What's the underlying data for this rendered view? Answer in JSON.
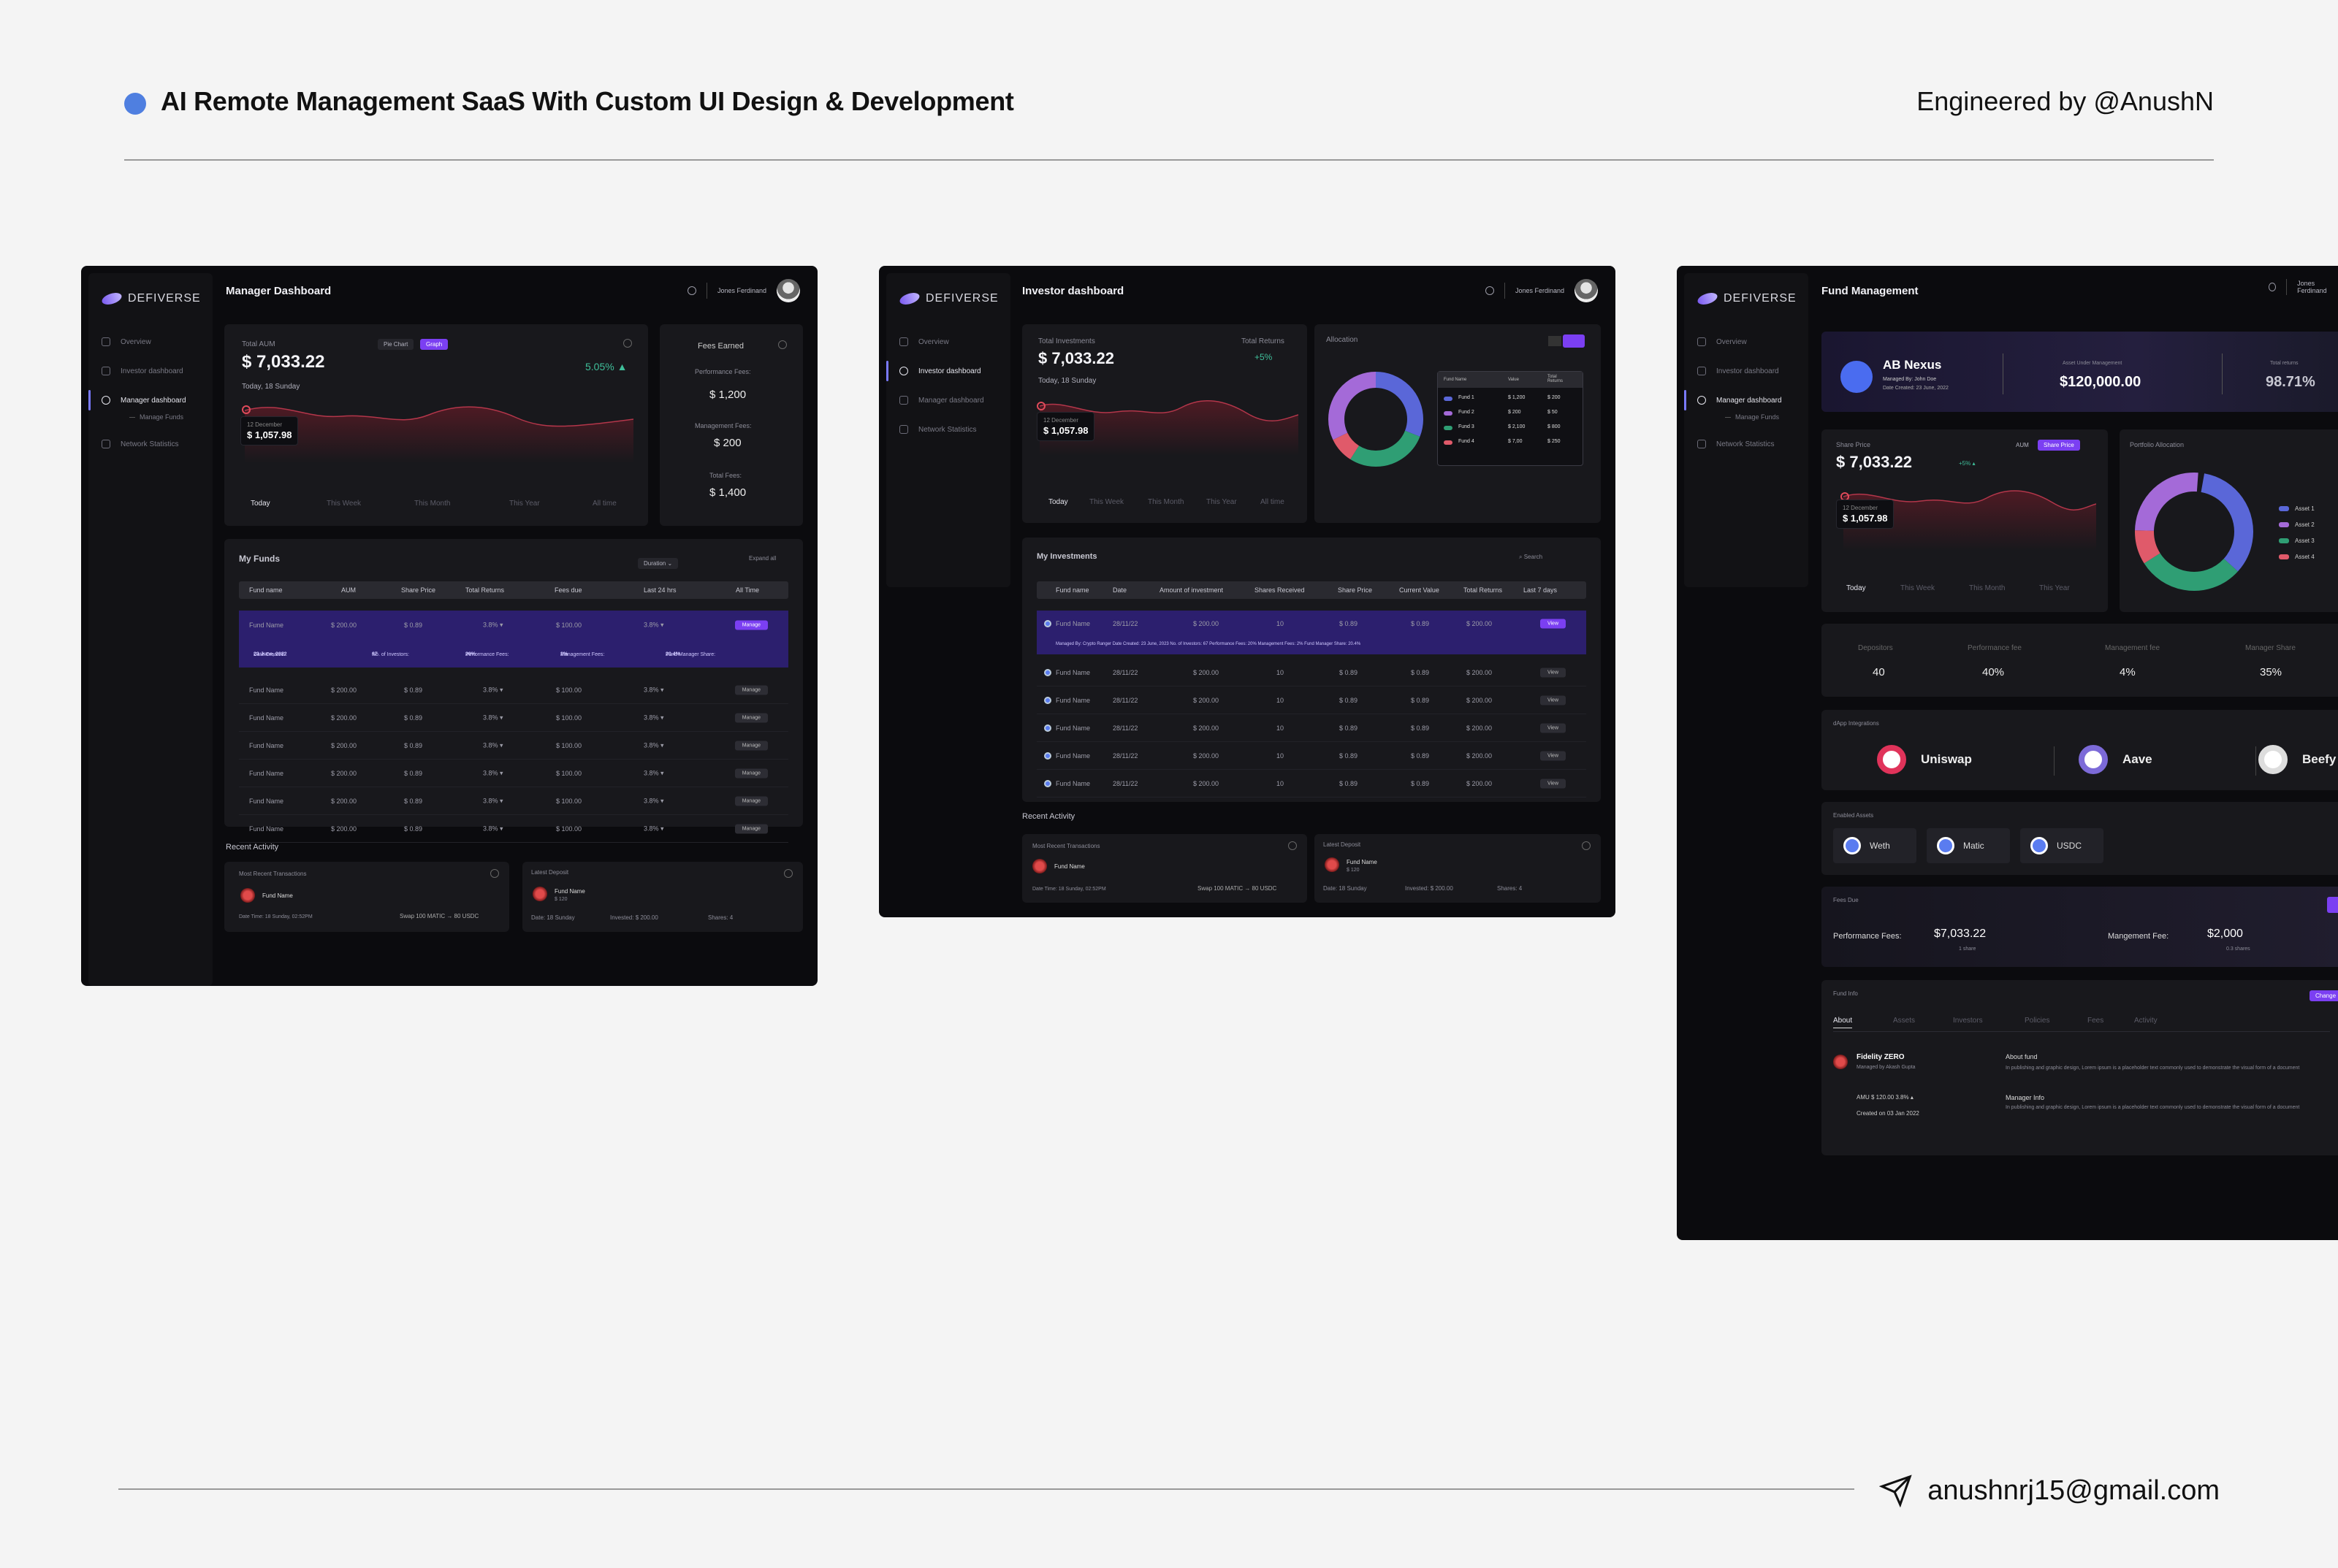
{
  "header": {
    "title": "AI Remote Management SaaS With Custom UI Design & Development",
    "credit": "Engineered by @AnushN"
  },
  "footer": {
    "email": "anushnrj15@gmail.com"
  },
  "brand": "DEFIVERSE",
  "user": "Jones Ferdinand",
  "nav": {
    "overview": "Overview",
    "investor": "Investor dashboard",
    "manager": "Manager dashboard",
    "manage_funds": "Manage Funds",
    "network": "Network Statistics"
  },
  "s1": {
    "title": "Manager Dashboard",
    "aum_label": "Total AUM",
    "aum": "$ 7,033.22",
    "aum_change": "5.05% ▲",
    "date": "Today, 18 Sunday",
    "toggle": [
      "Pie Chart",
      "Graph"
    ],
    "tip_date": "12 December",
    "tip_val": "$ 1,057.98",
    "ranges": [
      "Today",
      "This Week",
      "This Month",
      "This Year",
      "All time"
    ],
    "fees": {
      "title": "Fees Earned",
      "perf_l": "Performance Fees:",
      "perf": "$ 1,200",
      "mgmt_l": "Management Fees:",
      "mgmt": "$ 200",
      "tot_l": "Total Fees:",
      "tot": "$ 1,400"
    },
    "funds_title": "My Funds",
    "duration": "Duration ⌄",
    "expand": "Expand all",
    "cols": [
      "Fund name",
      "AUM",
      "Share Price",
      "Total Returns",
      "Fees due",
      "Last 24 hrs",
      "All Time"
    ],
    "row": [
      "Fund Name",
      "$ 200.00",
      "$ 0.89",
      "3.8% ▾",
      "$ 100.00",
      "3.8% ▾",
      "Manage"
    ],
    "detail": {
      "created_l": "Date Created:",
      "created": "23 June, 2022",
      "inv_l": "No. of Investors:",
      "inv": "67",
      "perf_l": "Performance Fees:",
      "perf": "20%",
      "mgmt_l": "Management Fees:",
      "mgmt": "2%",
      "share_l": "Fund Manager Share:",
      "share": "20.4%"
    },
    "recent": "Recent Activity",
    "tx": {
      "title": "Most Recent Transactions",
      "fund": "Fund Name",
      "time": "Date Time: 18 Sunday, 02:52PM",
      "swap": "Swap 100 MATIC → 80 USDC"
    },
    "dep": {
      "title": "Latest Deposit",
      "fund": "Fund Name",
      "sub": "$ 120",
      "date": "Date: 18 Sunday",
      "inv": "Invested: $ 200.00",
      "shares": "Shares: 4"
    }
  },
  "s2": {
    "title": "Investor dashboard",
    "inv_label": "Total Investments",
    "inv": "$ 7,033.22",
    "ret_label": "Total Returns",
    "ret": "+5%",
    "date": "Today, 18 Sunday",
    "tip_date": "12 December",
    "tip_val": "$ 1,057.98",
    "ranges": [
      "Today",
      "This Week",
      "This Month",
      "This Year",
      "All time"
    ],
    "alloc": "Allocation",
    "legend_cols": [
      "Fund Name",
      "Value",
      "Total Returns"
    ],
    "legend": [
      [
        "Fund 1",
        "$ 1,200",
        "$ 200"
      ],
      [
        "Fund 2",
        "$ 200",
        "$ 50"
      ],
      [
        "Fund 3",
        "$ 2,100",
        "$ 800"
      ],
      [
        "Fund 4",
        "$ 7,00",
        "$ 250"
      ]
    ],
    "inv_title": "My Investments",
    "search": "Search",
    "cols": [
      "Fund name",
      "Date",
      "Amount of investment",
      "Shares Received",
      "Share Price",
      "Current Value",
      "Total Returns",
      "Last 7 days"
    ],
    "row": [
      "Fund Name",
      "28/11/22",
      "$ 200.00",
      "10",
      "$ 0.89",
      "$ 0.89",
      "$ 200.00",
      "View"
    ],
    "detail": "Managed By: Crypto Ranger   Date Created: 23 June, 2023   No. of Investors: 67   Performance Fees: 20%   Management Fees: 2%   Fund Manager Share: 20.4%",
    "recent": "Recent Activity",
    "tx": {
      "title": "Most Recent Transactions",
      "fund": "Fund Name",
      "time": "Date Time: 18 Sunday, 02:52PM",
      "swap": "Swap 100 MATIC → 80 USDC"
    },
    "dep": {
      "title": "Latest Deposit",
      "fund": "Fund Name",
      "sub": "$ 120",
      "date": "Date: 18 Sunday",
      "inv": "Invested: $ 200.00",
      "shares": "Shares: 4"
    }
  },
  "s3": {
    "title": "Fund Management",
    "fund": "AB Nexus",
    "mgr": "Managed By: John Doe",
    "created": "Date Created: 23 June, 2022",
    "aum_l": "Asset Under Management",
    "aum": "$120,000.00",
    "ret_l": "Total returns",
    "ret": "98.71%",
    "sp_l": "Share Price",
    "sp": "$ 7,033.22",
    "sp_ch": "+5% ▴",
    "toggle": [
      "AUM",
      "Share Price"
    ],
    "tip_date": "12 December",
    "tip_val": "$ 1,057.98",
    "ranges": [
      "Today",
      "This Week",
      "This Month",
      "This Year"
    ],
    "pa": "Portfolio Allocation",
    "assets": [
      "Asset 1",
      "Asset 2",
      "Asset 3",
      "Asset 4"
    ],
    "stats": [
      [
        "Depositors",
        "40"
      ],
      [
        "Performance fee",
        "40%"
      ],
      [
        "Management fee",
        "4%"
      ],
      [
        "Manager Share",
        "35%"
      ]
    ],
    "dapp": "dApp Integrations",
    "dapps": [
      "Uniswap",
      "Aave",
      "Beefy"
    ],
    "enabled": "Enabled Assets",
    "tokens": [
      "Weth",
      "Matic",
      "USDC"
    ],
    "fees_due": "Fees Due",
    "pf_l": "Performance Fees:",
    "pf": "$7,033.22",
    "pf_s": "1 share",
    "mf_l": "Mangement Fee:",
    "mf": "$2,000",
    "mf_s": "0.3 shares",
    "info": "Fund Info",
    "change": "Change",
    "tabs": [
      "About",
      "Assets",
      "Investors",
      "Policies",
      "Fees",
      "Activity"
    ],
    "fz": "Fidelity ZERO",
    "fz_m": "Managed by Akash Gupta",
    "amu": "AMU $ 120.00 3.8% ▴",
    "created_on": "Created on 03 Jan 2022",
    "about_t": "About fund",
    "about": "In publishing and graphic design, Lorem ipsum is a placeholder text commonly used to demonstrate the visual form of a document",
    "minfo_t": "Manager Info",
    "minfo": "In publishing and graphic design, Lorem ipsum is a placeholder text commonly used to demonstrate the visual form of a document"
  }
}
